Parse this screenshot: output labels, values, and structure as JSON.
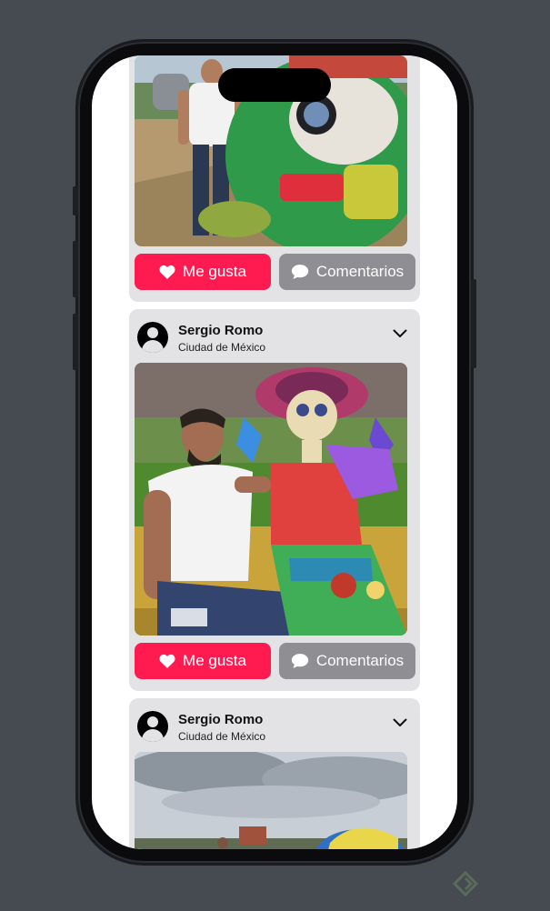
{
  "colors": {
    "background": "#464a51",
    "card": "#e3e3e6",
    "like_button": "#ff1a4f",
    "comment_button": "#8e8e93"
  },
  "posts": [
    {
      "like_label": "Me gusta",
      "comment_label": "Comentarios"
    },
    {
      "user_name": "Sergio Romo",
      "location": "Ciudad de México",
      "like_label": "Me gusta",
      "comment_label": "Comentarios"
    },
    {
      "user_name": "Sergio Romo",
      "location": "Ciudad de México"
    }
  ],
  "icons": [
    "heart-icon",
    "speech-bubble-icon",
    "chevron-down-icon",
    "person-circle-icon"
  ]
}
